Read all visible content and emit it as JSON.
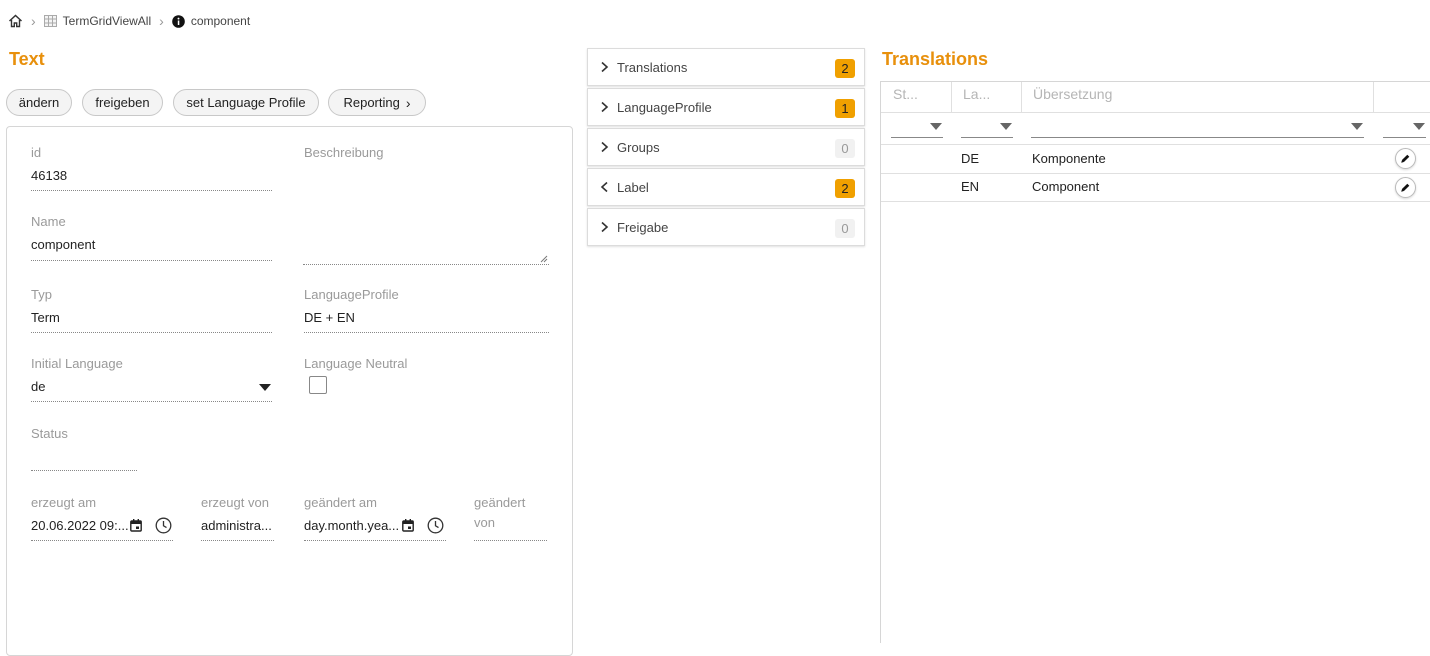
{
  "breadcrumb": {
    "items": [
      {
        "label": "TermGridViewAll",
        "icon": "table-icon"
      },
      {
        "label": "component",
        "icon": "info-icon"
      }
    ]
  },
  "left": {
    "title": "Text",
    "buttons": {
      "change": "ändern",
      "release": "freigeben",
      "language_profile": "set Language Profile",
      "reporting": "Reporting"
    },
    "fields": {
      "id": {
        "label": "id",
        "value": "46138"
      },
      "description": {
        "label": "Beschreibung",
        "value": ""
      },
      "name": {
        "label": "Name",
        "value": "component"
      },
      "type": {
        "label": "Typ",
        "value": "Term"
      },
      "language_profile": {
        "label": "LanguageProfile",
        "value": "DE + EN"
      },
      "initial_language": {
        "label": "Initial Language",
        "value": "de"
      },
      "language_neutral": {
        "label": "Language Neutral",
        "checked": false
      },
      "status": {
        "label": "Status",
        "value": ""
      },
      "created_at": {
        "label": "erzeugt am",
        "value": "20.06.2022 09:..."
      },
      "created_by": {
        "label": "erzeugt von",
        "value": "administra..."
      },
      "changed_at": {
        "label": "geändert am",
        "value": "day.month.yea..."
      },
      "changed_by": {
        "label_line1": "geändert",
        "label_line2": "von",
        "value": ""
      }
    }
  },
  "accordion": [
    {
      "label": "Translations",
      "count": "2",
      "active": true,
      "expanded": false
    },
    {
      "label": "LanguageProfile",
      "count": "1",
      "active": true,
      "expanded": false
    },
    {
      "label": "Groups",
      "count": "0",
      "active": false,
      "expanded": false
    },
    {
      "label": "Label",
      "count": "2",
      "active": true,
      "expanded": true
    },
    {
      "label": "Freigabe",
      "count": "0",
      "active": false,
      "expanded": false
    }
  ],
  "right": {
    "title": "Translations",
    "columns": [
      "St...",
      "La...",
      "Übersetzung",
      ""
    ],
    "rows": [
      {
        "status": "",
        "language": "DE",
        "translation": "Komponente"
      },
      {
        "status": "",
        "language": "EN",
        "translation": "Component"
      }
    ]
  },
  "colors": {
    "accent": "#e8900c",
    "badge_active": "#f0a000",
    "badge_inactive": "#f1f1f1"
  }
}
